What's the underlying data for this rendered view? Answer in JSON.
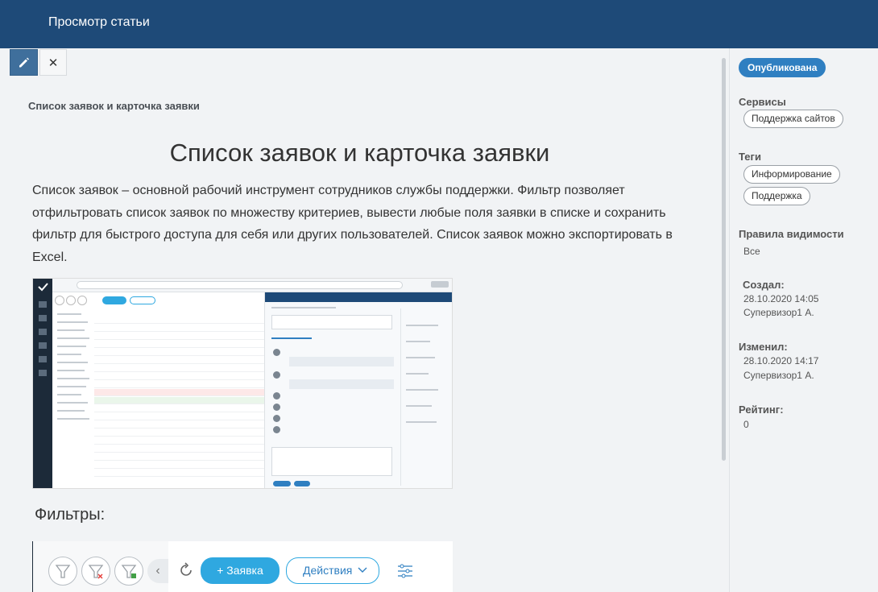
{
  "header": {
    "title": "Просмотр статьи"
  },
  "toolbar": {
    "edit_icon": "pencil-icon",
    "close_icon": "close-icon",
    "close_glyph": "✕"
  },
  "article": {
    "breadcrumb": "Список заявок и карточка заявки",
    "heading": "Список заявок и карточка заявки",
    "intro": "Список заявок – основной рабочий инструмент сотрудников службы поддержки. Фильтр позволяет отфильтровать список заявок по множеству критериев, вывести любые поля заявки в списке и сохранить фильтр для быстрого доступа для себя или других пользователей. Список заявок можно экспортировать в Excel.",
    "filters_heading": "Фильтры:",
    "filters_image": {
      "new_request_label": "+ Заявка",
      "actions_label": "Действия"
    }
  },
  "sidebar": {
    "status": "Опубликована",
    "services_label": "Сервисы",
    "services": [
      "Поддержка сайтов"
    ],
    "tags_label": "Теги",
    "tags": [
      "Информирование",
      "Поддержка"
    ],
    "visibility_label": "Правила видимости",
    "visibility_value": "Все",
    "created_label": "Создал:",
    "created_date": "28.10.2020 14:05",
    "created_by": "Супервизор1 А.",
    "modified_label": "Изменил:",
    "modified_date": "28.10.2020 14:17",
    "modified_by": "Супервизор1 А.",
    "rating_label": "Рейтинг:",
    "rating_value": "0"
  },
  "colors": {
    "header": "#1e4a78",
    "accent": "#2f7fc1",
    "edit_button": "#3f6f9c",
    "page_bg": "#f1f3f5"
  }
}
